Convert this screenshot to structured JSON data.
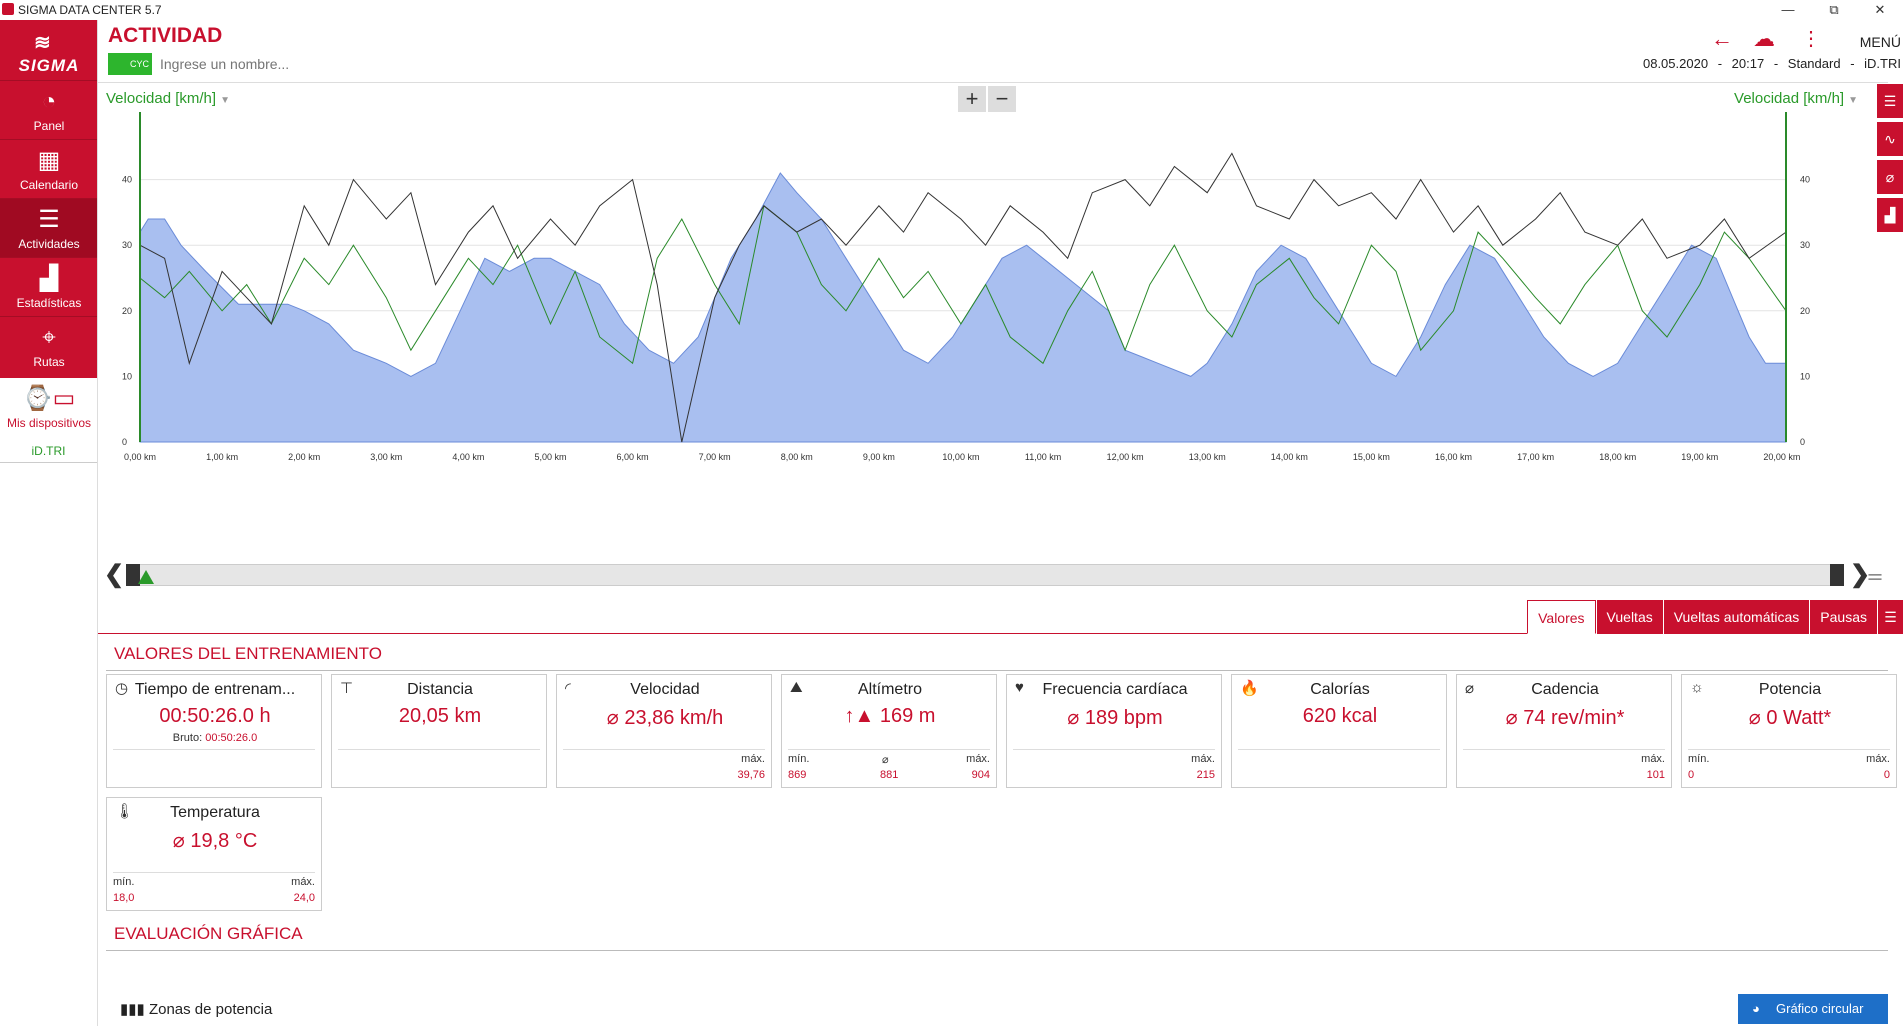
{
  "window": {
    "title": "SIGMA DATA CENTER 5.7",
    "minimize": "—",
    "restore": "⧉",
    "close": "✕"
  },
  "sidebar": {
    "logo": "SIGMA",
    "items": [
      {
        "label": "Panel",
        "icon": "gauge-icon",
        "glyph": "◔"
      },
      {
        "label": "Calendario",
        "icon": "calendar-icon",
        "glyph": "▦"
      },
      {
        "label": "Actividades",
        "icon": "list-icon",
        "glyph": "☰"
      },
      {
        "label": "Estadísticas",
        "icon": "bar-chart-icon",
        "glyph": "▟"
      },
      {
        "label": "Rutas",
        "icon": "route-icon",
        "glyph": "⌖"
      }
    ],
    "devices_label": "Mis dispositivos",
    "device_name": "iD.TRI"
  },
  "header": {
    "title": "ACTIVIDAD",
    "sport_badge": "CYC",
    "name_placeholder": "Ingrese un nombre...",
    "menu_label": "MENÚ",
    "date": "08.05.2020",
    "time": "20:17",
    "profile": "Standard",
    "device": "iD.TRI",
    "separator": "-"
  },
  "chart": {
    "left_axis_label": "Velocidad [km/h]",
    "right_axis_label": "Velocidad [km/h]",
    "zoom_in": "+",
    "zoom_out": "−"
  },
  "chart_data": {
    "type": "line",
    "xlabel": "",
    "ylabel": "Velocidad [km/h]",
    "x_unit": "km",
    "xlim": [
      0,
      20.05
    ],
    "ylim": [
      0,
      50
    ],
    "x_ticks": [
      "0,00 km",
      "1,00 km",
      "2,00 km",
      "3,00 km",
      "4,00 km",
      "5,00 km",
      "6,00 km",
      "7,00 km",
      "8,00 km",
      "9,00 km",
      "10,00 km",
      "11,00 km",
      "12,00 km",
      "13,00 km",
      "14,00 km",
      "15,00 km",
      "16,00 km",
      "17,00 km",
      "18,00 km",
      "19,00 km",
      "20,00 km"
    ],
    "y_ticks": [
      0,
      10,
      20,
      30,
      40
    ],
    "grid": true,
    "series": [
      {
        "color": "#a9bff0",
        "kind": "area",
        "x": [
          0,
          0.1,
          0.3,
          0.5,
          0.8,
          1.2,
          1.5,
          1.8,
          2.0,
          2.3,
          2.6,
          3.0,
          3.3,
          3.6,
          3.9,
          4.2,
          4.5,
          4.8,
          5.0,
          5.3,
          5.6,
          5.9,
          6.2,
          6.5,
          6.8,
          7.0,
          7.2,
          7.5,
          7.8,
          8.0,
          8.3,
          8.6,
          9.0,
          9.3,
          9.6,
          9.9,
          10.2,
          10.5,
          10.8,
          11.0,
          11.4,
          11.8,
          12.0,
          12.4,
          12.8,
          13.0,
          13.3,
          13.6,
          13.9,
          14.2,
          14.5,
          14.8,
          15.0,
          15.3,
          15.6,
          15.9,
          16.2,
          16.5,
          16.8,
          17.1,
          17.4,
          17.7,
          18.0,
          18.3,
          18.6,
          18.9,
          19.2,
          19.4,
          19.6,
          19.8,
          20.05
        ],
        "y": [
          32,
          34,
          34,
          30,
          26,
          21,
          21,
          21,
          20,
          18,
          14,
          12,
          10,
          12,
          20,
          28,
          26,
          28,
          28,
          26,
          24,
          18,
          14,
          12,
          16,
          22,
          28,
          34,
          41,
          38,
          34,
          28,
          20,
          14,
          12,
          16,
          22,
          28,
          30,
          28,
          24,
          20,
          14,
          12,
          10,
          12,
          18,
          26,
          30,
          28,
          22,
          16,
          12,
          10,
          16,
          24,
          30,
          28,
          22,
          16,
          12,
          10,
          12,
          18,
          24,
          30,
          28,
          22,
          16,
          12,
          12
        ]
      },
      {
        "color": "#2a8a2a",
        "kind": "line",
        "x": [
          0,
          0.3,
          0.6,
          1.0,
          1.3,
          1.6,
          2.0,
          2.3,
          2.6,
          3.0,
          3.3,
          3.6,
          4.0,
          4.3,
          4.6,
          5.0,
          5.3,
          5.6,
          6.0,
          6.3,
          6.6,
          7.0,
          7.3,
          7.6,
          8.0,
          8.3,
          8.6,
          9.0,
          9.3,
          9.6,
          10.0,
          10.3,
          10.6,
          11.0,
          11.3,
          11.6,
          12.0,
          12.3,
          12.6,
          13.0,
          13.3,
          13.6,
          14.0,
          14.3,
          14.6,
          15.0,
          15.3,
          15.6,
          16.0,
          16.3,
          16.6,
          17.0,
          17.3,
          17.6,
          18.0,
          18.3,
          18.6,
          19.0,
          19.3,
          19.6,
          20.05
        ],
        "y": [
          25,
          22,
          26,
          20,
          24,
          18,
          28,
          24,
          30,
          22,
          14,
          20,
          28,
          24,
          30,
          18,
          26,
          16,
          12,
          28,
          34,
          24,
          18,
          36,
          32,
          24,
          20,
          28,
          22,
          26,
          18,
          24,
          16,
          12,
          20,
          26,
          14,
          24,
          30,
          20,
          16,
          24,
          28,
          22,
          18,
          30,
          26,
          14,
          20,
          32,
          28,
          22,
          18,
          24,
          30,
          20,
          16,
          24,
          32,
          28,
          20
        ]
      },
      {
        "color": "#333333",
        "kind": "line",
        "x": [
          0,
          0.3,
          0.6,
          1.0,
          1.3,
          1.6,
          2.0,
          2.3,
          2.6,
          3.0,
          3.3,
          3.6,
          4.0,
          4.3,
          4.6,
          5.0,
          5.3,
          5.6,
          6.0,
          6.3,
          6.6,
          7.0,
          7.3,
          7.6,
          8.0,
          8.3,
          8.6,
          9.0,
          9.3,
          9.6,
          10.0,
          10.3,
          10.6,
          11.0,
          11.3,
          11.6,
          12.0,
          12.3,
          12.6,
          13.0,
          13.3,
          13.6,
          14.0,
          14.3,
          14.6,
          15.0,
          15.3,
          15.6,
          16.0,
          16.3,
          16.6,
          17.0,
          17.3,
          17.6,
          18.0,
          18.3,
          18.6,
          19.0,
          19.3,
          19.6,
          20.05
        ],
        "y": [
          30,
          28,
          12,
          26,
          22,
          18,
          36,
          30,
          40,
          34,
          38,
          24,
          32,
          36,
          28,
          34,
          30,
          36,
          40,
          24,
          0,
          22,
          30,
          36,
          32,
          34,
          30,
          36,
          32,
          38,
          34,
          30,
          36,
          32,
          28,
          38,
          40,
          36,
          42,
          38,
          44,
          36,
          34,
          40,
          36,
          38,
          34,
          40,
          32,
          36,
          30,
          34,
          38,
          32,
          30,
          34,
          28,
          30,
          34,
          28,
          32
        ]
      }
    ]
  },
  "tabs": [
    {
      "label": "Valores",
      "active": true
    },
    {
      "label": "Vueltas",
      "active": false
    },
    {
      "label": "Vueltas automáticas",
      "active": false
    },
    {
      "label": "Pausas",
      "active": false
    }
  ],
  "values_section": {
    "title": "VALORES DEL ENTRENAMIENTO",
    "cards": [
      {
        "title": "Tiempo de entrenam...",
        "icon": "clock-icon",
        "glyph": "◷",
        "value": "00:50:26.0 h",
        "sub_label": "Bruto:",
        "sub_value": "00:50:26.0"
      },
      {
        "title": "Distancia",
        "icon": "signpost-icon",
        "glyph": "⊤",
        "value": "20,05 km"
      },
      {
        "title": "Velocidad",
        "icon": "speedometer-icon",
        "glyph": "◜",
        "value": "⌀ 23,86 km/h",
        "max_label": "máx.",
        "max_value": "39,76"
      },
      {
        "title": "Altímetro",
        "icon": "mountain-icon",
        "glyph": "⛰",
        "value": "↑▲ 169 m",
        "min_label": "mín.",
        "min_value": "869",
        "avg_label": "⌀",
        "avg_value": "881",
        "max_label": "máx.",
        "max_value": "904"
      },
      {
        "title": "Frecuencia cardíaca",
        "icon": "heart-icon",
        "glyph": "♥",
        "value": "⌀ 189 bpm",
        "max_label": "máx.",
        "max_value": "215"
      },
      {
        "title": "Calorías",
        "icon": "flame-icon",
        "glyph": "🔥",
        "value": "620 kcal"
      },
      {
        "title": "Cadencia",
        "icon": "pedal-icon",
        "glyph": "⌀",
        "value": "⌀ 74 rev/min*",
        "max_label": "máx.",
        "max_value": "101"
      },
      {
        "title": "Potencia",
        "icon": "bulb-icon",
        "glyph": "☼",
        "value": "⌀ 0 Watt*",
        "min_label": "mín.",
        "min_value": "0",
        "max_label": "máx.",
        "max_value": "0"
      },
      {
        "title": "Temperatura",
        "icon": "thermometer-icon",
        "glyph": "🌡",
        "value": "⌀ 19,8 °C",
        "min_label": "mín.",
        "min_value": "18,0",
        "max_label": "máx.",
        "max_value": "24,0"
      }
    ]
  },
  "graph_section": {
    "title": "EVALUACIÓN GRÁFICA",
    "zones_label": "Zonas de potencia",
    "pie_button": "Gráfico circular"
  },
  "colors": {
    "brand": "#c8102e",
    "speed_area": "#a9bff0",
    "green_line": "#2a8a2a",
    "accent_blue": "#1e6fc8"
  }
}
